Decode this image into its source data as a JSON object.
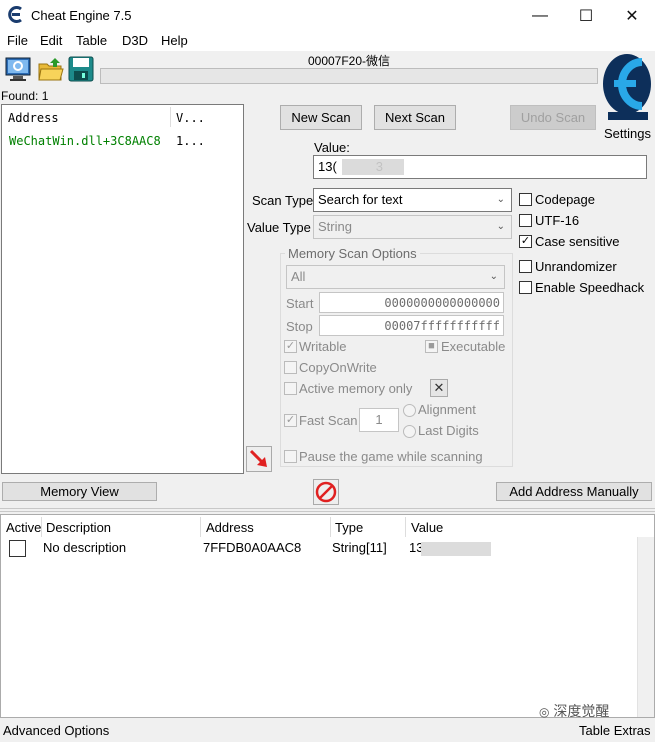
{
  "window": {
    "title": "Cheat Engine 7.5",
    "process": "00007F20-微信",
    "minimize": "—",
    "maximize": "☐",
    "close": "✕"
  },
  "menu": [
    "File",
    "Edit",
    "Table",
    "D3D",
    "Help"
  ],
  "found": "Found: 1",
  "results": {
    "col_address": "Address",
    "col_value": "V...",
    "row_address": "WeChatWin.dll+3C8AAC8",
    "row_value": "1..."
  },
  "scan_buttons": {
    "new_scan": "New Scan",
    "next_scan": "Next Scan",
    "undo_scan": "Undo Scan",
    "settings": "Settings"
  },
  "value": {
    "label": "Value:",
    "input": "13(   3"
  },
  "scan_type": {
    "label": "Scan Type",
    "selected": "Search for text"
  },
  "value_type": {
    "label": "Value Type",
    "selected": "String"
  },
  "memory_options": {
    "title": "Memory Scan Options",
    "region": "All",
    "start_label": "Start",
    "start_value": "0000000000000000",
    "stop_label": "Stop",
    "stop_value": "00007fffffffffff",
    "writable": "Writable",
    "executable": "Executable",
    "copy_on_write": "CopyOnWrite",
    "active_memory_only": "Active memory only",
    "fast_scan": "Fast Scan",
    "fast_scan_value": "1",
    "alignment": "Alignment",
    "last_digits": "Last Digits",
    "pause_game": "Pause the game while scanning"
  },
  "options": {
    "codepage": "Codepage",
    "utf16": "UTF-16",
    "case_sensitive": "Case sensitive",
    "unrandomizer": "Unrandomizer",
    "speedhack": "Enable Speedhack"
  },
  "bottom_buttons": {
    "memory_view": "Memory View",
    "add_manually": "Add Address Manually"
  },
  "table": {
    "headers": [
      "Active",
      "Description",
      "Address",
      "Type",
      "Value"
    ],
    "rows": [
      {
        "description": "No description",
        "address": "7FFDB0A0AAC8",
        "type": "String[11]",
        "value": "13   "
      }
    ]
  },
  "footer": {
    "advanced": "Advanced Options",
    "extras": "Table Extras",
    "watermark": "深度觉醒"
  },
  "icons": [
    "cheat-engine-icon",
    "computer-icon",
    "open-folder-icon",
    "save-icon",
    "red-arrow-icon",
    "no-entry-icon",
    "settings-logo-icon"
  ],
  "colors": {
    "green_text": "#008000",
    "accent_red": "#e02020"
  }
}
